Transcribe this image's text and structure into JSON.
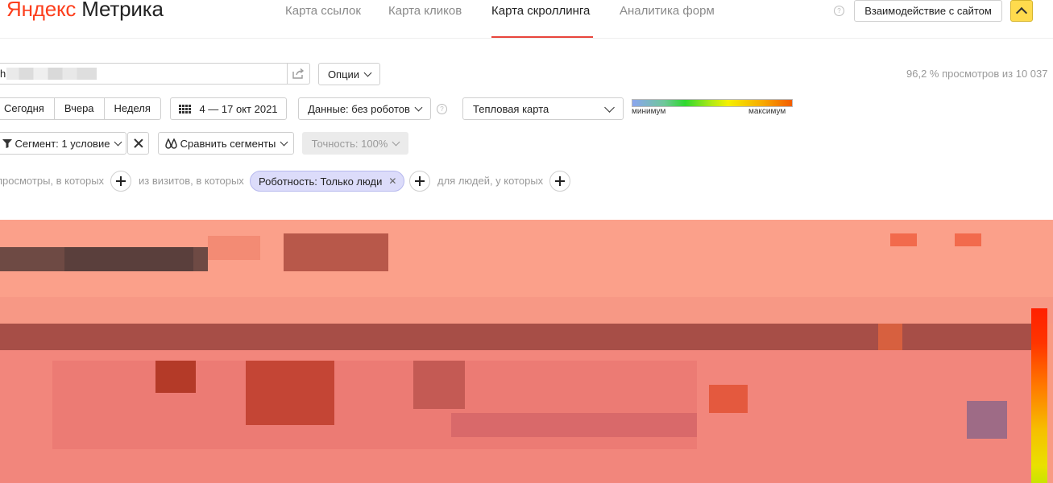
{
  "header": {
    "logo_brand": "Яндекс",
    "logo_product": "Метрика",
    "nav_tabs": [
      {
        "label": "Карта ссылок",
        "active": false
      },
      {
        "label": "Карта кликов",
        "active": false
      },
      {
        "label": "Карта скроллинга",
        "active": true
      },
      {
        "label": "Аналитика форм",
        "active": false
      }
    ],
    "help_icon": "?",
    "interaction_button": "Взаимодействие с сайтом",
    "collapse_icon": "chevron-up-icon",
    "accent_color": "#e8453c",
    "brand_color": "#fc3f1d",
    "button_yellow": "#ffdb4d"
  },
  "url_bar": {
    "value": "h",
    "share_icon": "share-icon",
    "options_label": "Опции"
  },
  "stats": {
    "views_text": "96,2 % просмотров из 10 037"
  },
  "period": {
    "presets": [
      "Сегодня",
      "Вчера",
      "Неделя"
    ],
    "date_range": "4 — 17 окт 2021",
    "data_filter": "Данные: без роботов",
    "map_type": "Тепловая карта",
    "legend_min": "минимум",
    "legend_max": "максимум"
  },
  "segment": {
    "segment_label": "Сегмент: 1 условие",
    "compare_label": "Сравнить сегменты",
    "accuracy_label": "Точность: 100%"
  },
  "filters": {
    "views_text": "просмотры, в которых",
    "visits_text": "из визитов, в которых",
    "chip_label": "Роботность: Только люди",
    "people_text": "для людей, у которых"
  }
}
